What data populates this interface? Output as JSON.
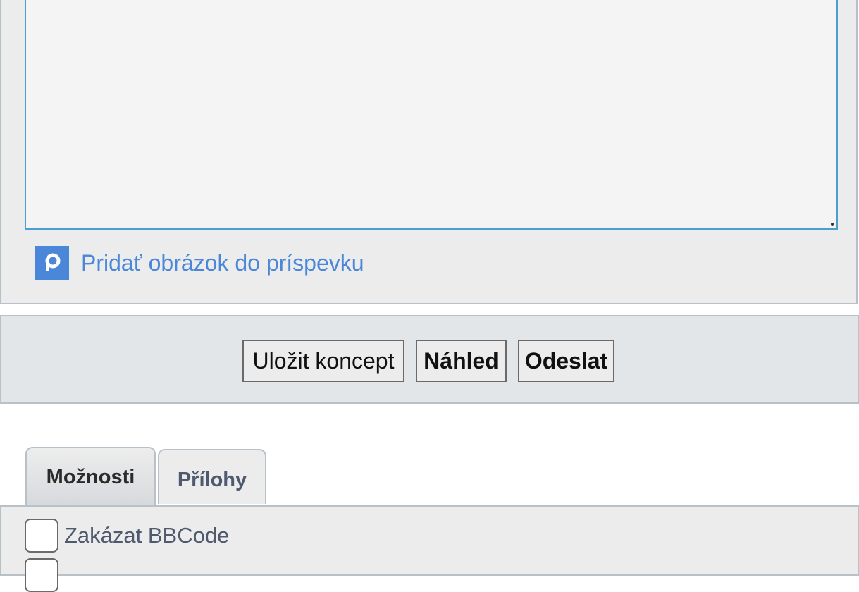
{
  "editor": {
    "message_value": "",
    "add_image_label": "Pridať obrázok do príspevku",
    "add_image_icon": "postimage-p-icon"
  },
  "submit_bar": {
    "save_draft_label": "Uložit koncept",
    "preview_label": "Náhled",
    "submit_label": "Odeslat"
  },
  "tabs": [
    {
      "label": "Možnosti",
      "active": true
    },
    {
      "label": "Přílohy",
      "active": false
    }
  ],
  "options": [
    {
      "label": "Zakázat BBCode",
      "checked": false
    },
    {
      "label": "",
      "checked": false
    }
  ],
  "colors": {
    "link": "#4a87d8",
    "textarea_border": "#4a9fd0",
    "panel_bg": "#ececec",
    "panel_border": "#b9c1c8"
  }
}
